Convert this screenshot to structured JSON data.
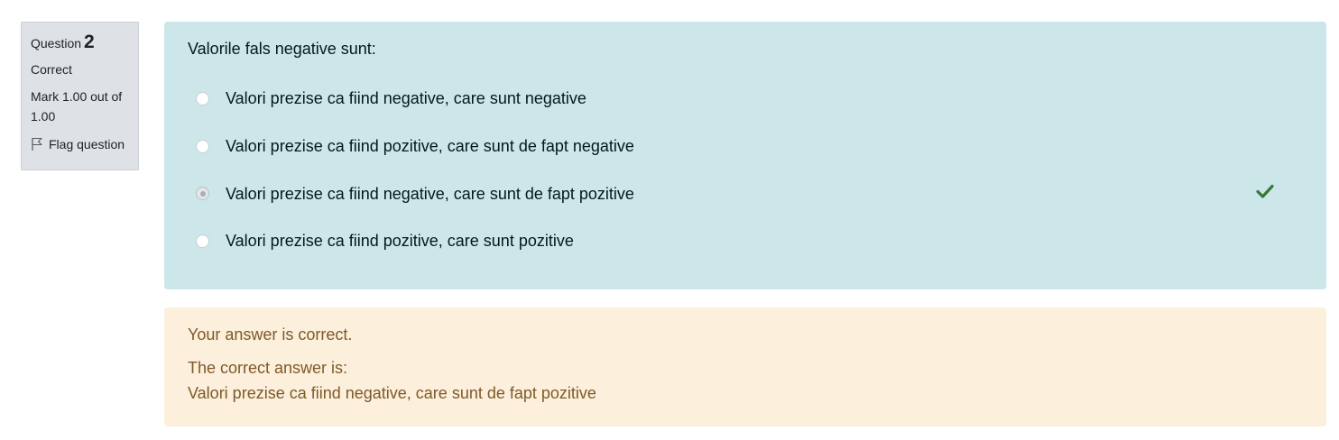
{
  "info": {
    "question_prefix": "Question",
    "question_number": "2",
    "state": "Correct",
    "grade": "Mark 1.00 out of 1.00",
    "flag_label": "Flag question",
    "flag_icon": "flag-icon"
  },
  "question": {
    "text": "Valorile fals negative sunt:",
    "options": [
      {
        "label": "Valori prezise ca fiind negative, care sunt negative",
        "selected": false
      },
      {
        "label": "Valori prezise ca fiind pozitive, care sunt de fapt negative",
        "selected": false
      },
      {
        "label": "Valori prezise ca fiind negative, care sunt de fapt pozitive",
        "selected": true,
        "marked_correct": true
      },
      {
        "label": "Valori prezise ca fiind pozitive, care sunt pozitive",
        "selected": false
      }
    ],
    "correct_icon": "checkmark-icon"
  },
  "feedback": {
    "specific": "Your answer is correct.",
    "correct_answer_intro": "The correct answer is:",
    "correct_answer": "Valori prezise ca fiind negative, care sunt de fapt pozitive"
  },
  "colors": {
    "content_bg": "#cce6ea",
    "feedback_bg": "#fcefdc",
    "info_bg": "#dee2e6",
    "correct_green": "#357a32"
  }
}
